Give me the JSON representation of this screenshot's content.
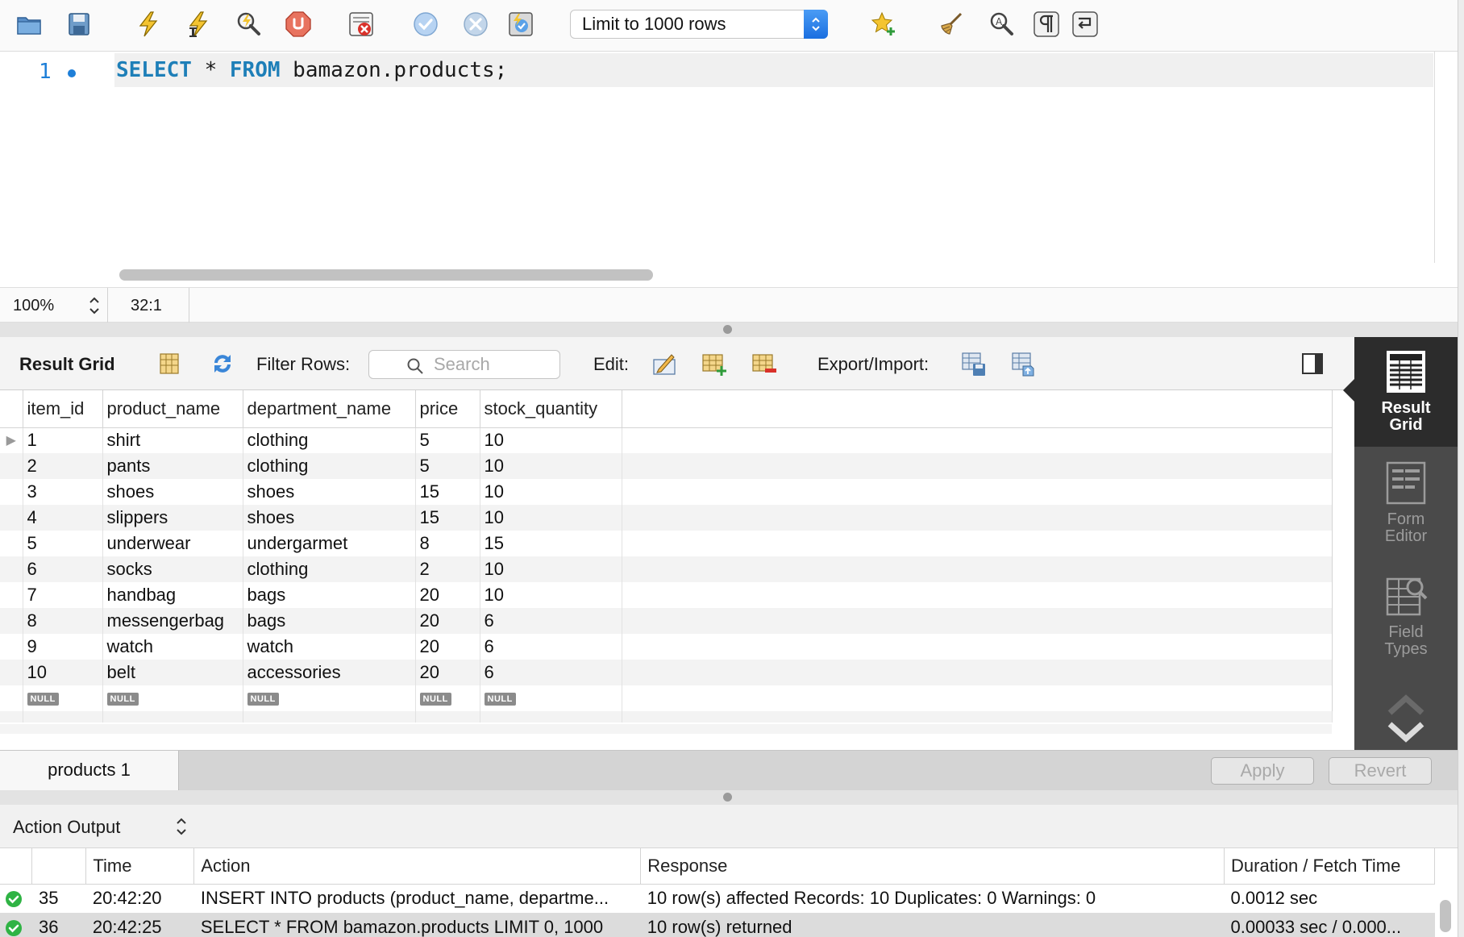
{
  "toolbar": {
    "limit_select": "Limit to 1000 rows",
    "icons": [
      "open-folder-icon",
      "save-icon",
      "execute-icon",
      "execute-current-icon",
      "explain-icon",
      "stop-icon",
      "toggle-error-icon",
      "commit-icon",
      "rollback-icon",
      "autocommit-icon",
      "bookmark-icon",
      "beautify-icon",
      "find-icon",
      "invisible-chars-icon",
      "wrap-icon"
    ]
  },
  "editor": {
    "line_number": "1",
    "sql_keyword_1": "SELECT",
    "sql_star": " * ",
    "sql_keyword_2": "FROM",
    "sql_rest": " bamazon.products;"
  },
  "editor_status": {
    "zoom": "100%",
    "cursor_position": "32:1"
  },
  "result_toolbar": {
    "title": "Result Grid",
    "filter_label": "Filter Rows:",
    "search_placeholder": "Search",
    "edit_label": "Edit:",
    "export_label": "Export/Import:"
  },
  "grid": {
    "columns": [
      "item_id",
      "product_name",
      "department_name",
      "price",
      "stock_quantity"
    ],
    "rows": [
      [
        "1",
        "shirt",
        "clothing",
        "5",
        "10"
      ],
      [
        "2",
        "pants",
        "clothing",
        "5",
        "10"
      ],
      [
        "3",
        "shoes",
        "shoes",
        "15",
        "10"
      ],
      [
        "4",
        "slippers",
        "shoes",
        "15",
        "10"
      ],
      [
        "5",
        "underwear",
        "undergarmet",
        "8",
        "15"
      ],
      [
        "6",
        "socks",
        "clothing",
        "2",
        "10"
      ],
      [
        "7",
        "handbag",
        "bags",
        "20",
        "10"
      ],
      [
        "8",
        "messengerbag",
        "bags",
        "20",
        "6"
      ],
      [
        "9",
        "watch",
        "watch",
        "20",
        "6"
      ],
      [
        "10",
        "belt",
        "accessories",
        "20",
        "6"
      ]
    ],
    "null_label": "NULL"
  },
  "rail": {
    "items": [
      {
        "line1": "Result",
        "line2": "Grid"
      },
      {
        "line1": "Form",
        "line2": "Editor"
      },
      {
        "line1": "Field",
        "line2": "Types"
      }
    ]
  },
  "tabs": {
    "active": "products 1",
    "apply": "Apply",
    "revert": "Revert"
  },
  "output": {
    "selector": "Action Output",
    "columns": [
      "",
      "Time",
      "Action",
      "Response",
      "Duration / Fetch Time"
    ],
    "rows": [
      {
        "num": "35",
        "time": "20:42:20",
        "action": "INSERT INTO products (product_name, departme...",
        "response": "10 row(s) affected Records: 10  Duplicates: 0  Warnings: 0",
        "duration": "0.0012 sec"
      },
      {
        "num": "36",
        "time": "20:42:25",
        "action": "SELECT * FROM bamazon.products LIMIT 0, 1000",
        "response": "10 row(s) returned",
        "duration": "0.00033 sec / 0.000..."
      }
    ]
  },
  "colors": {
    "keyword": "#1e7fb8",
    "line_number": "#1e7fd8",
    "rail_bg": "#4a4a4a",
    "rail_active": "#2c2c2c",
    "ok_green": "#2fb344"
  }
}
